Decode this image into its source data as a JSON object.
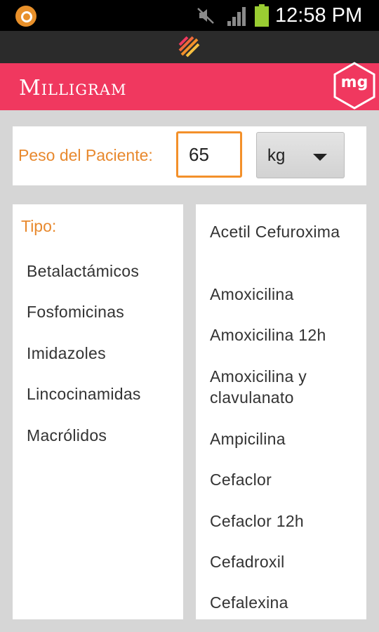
{
  "status_bar": {
    "time": "12:58 PM",
    "icons": [
      "app-notification-icon",
      "mute-icon",
      "signal-icon",
      "battery-icon"
    ]
  },
  "app": {
    "title": "Milligram",
    "logo": "mg",
    "accent_color": "#f0385f"
  },
  "weight": {
    "label": "Peso del Paciente:",
    "value": "65",
    "unit": "kg"
  },
  "types": {
    "header": "Tipo:",
    "items": [
      "Betalactámicos",
      "Fosfomicinas",
      "Imidazoles",
      "Lincocinamidas",
      "Macrólidos"
    ]
  },
  "drugs": {
    "items": [
      "Acetil Cefuroxima",
      "Amoxicilina",
      "Amoxicilina 12h",
      "Amoxicilina y clavulanato",
      "Ampicilina",
      "Cefaclor",
      "Cefaclor 12h",
      "Cefadroxil",
      "Cefalexina"
    ]
  }
}
